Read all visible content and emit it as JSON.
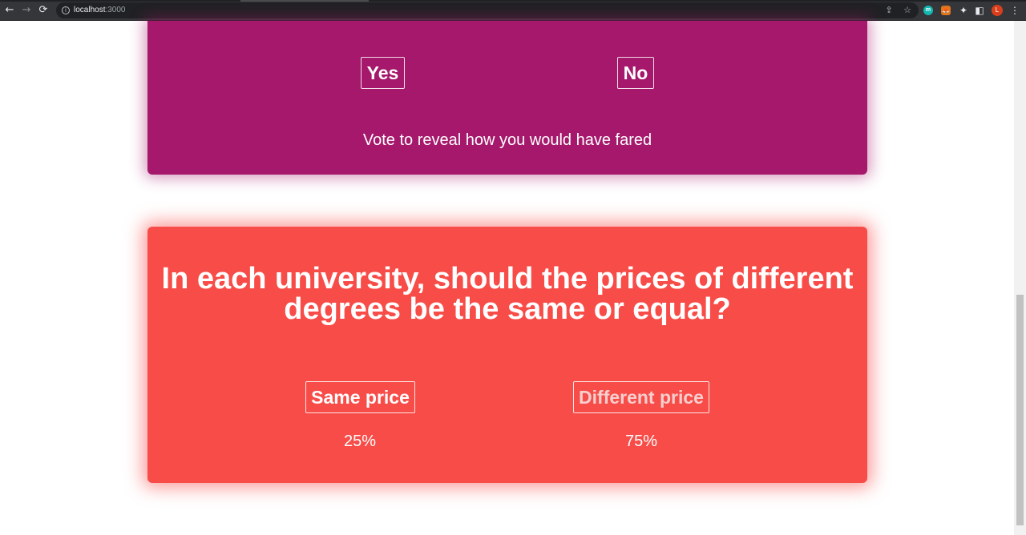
{
  "browser": {
    "url_host": "localhost",
    "url_port": ":3000",
    "nav": {
      "back": "←",
      "forward": "→",
      "reload": "⟳"
    },
    "icons": {
      "info": "i",
      "share": "⇪",
      "star": "☆",
      "puzzle": "✦",
      "sidepanel": "◧",
      "menu": "⋮"
    },
    "extensions": {
      "m_label": "m",
      "fox_label": "🦊"
    },
    "avatar_initial": "L"
  },
  "previous_poll": {
    "options": {
      "yes_label": "Yes",
      "no_label": "No"
    },
    "reveal_note": "Vote to reveal how you would have fared",
    "accent_color": "#a5186b"
  },
  "current_poll": {
    "question": "In each university, should the prices of different degrees be the same or equal?",
    "options": [
      {
        "label": "Same price",
        "percent": "25%"
      },
      {
        "label": "Different price",
        "percent": "75%"
      }
    ],
    "accent_color": "#f84c48"
  }
}
